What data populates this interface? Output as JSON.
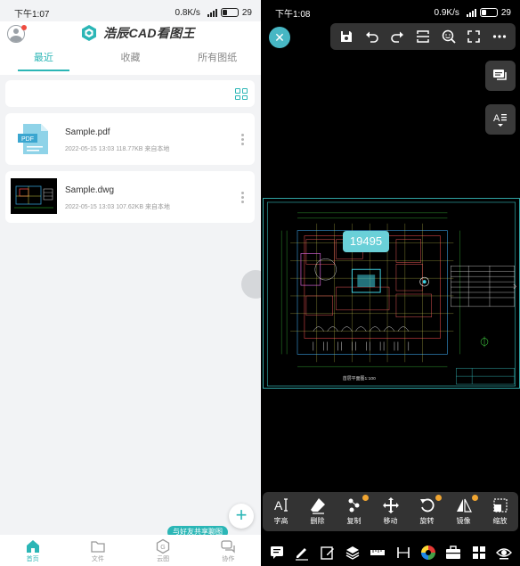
{
  "left": {
    "status": {
      "time": "下午1:07",
      "speed": "0.8K/s",
      "battery": "29"
    },
    "app_title": "浩辰CAD看图王",
    "tabs": [
      "最近",
      "收藏",
      "所有图纸"
    ],
    "files": [
      {
        "name": "Sample.pdf",
        "date": "2022-05-15 13:03",
        "size": "118.77KB",
        "source": "来自本地",
        "type": "PDF"
      },
      {
        "name": "Sample.dwg",
        "date": "2022-05-15 13:03",
        "size": "107.62KB",
        "source": "来自本地",
        "type": "DWG"
      }
    ],
    "share_bubble": "与好友共享聊图",
    "fab_label": "+",
    "bottom_nav": [
      "首页",
      "文件",
      "云图",
      "协作"
    ]
  },
  "right": {
    "status": {
      "time": "下午1:08",
      "speed": "0.9K/s",
      "battery": "29"
    },
    "dimension_value": "19495",
    "drawing_caption": "首层平面图1:100",
    "edit_tools": [
      {
        "label": "字高",
        "icon": "text-height-icon",
        "badge": false
      },
      {
        "label": "删除",
        "icon": "eraser-icon",
        "badge": false
      },
      {
        "label": "复制",
        "icon": "copy-icon",
        "badge": true
      },
      {
        "label": "移动",
        "icon": "move-icon",
        "badge": false
      },
      {
        "label": "旋转",
        "icon": "rotate-icon",
        "badge": true
      },
      {
        "label": "镜像",
        "icon": "mirror-icon",
        "badge": true
      },
      {
        "label": "缩放",
        "icon": "scale-icon",
        "badge": false
      }
    ],
    "bottom_tools": [
      "comment-icon",
      "pencil-icon",
      "edit-icon",
      "layers-icon",
      "ruler-icon",
      "measure-icon",
      "color-icon",
      "toolbox-icon",
      "grid-icon",
      "eye-icon"
    ],
    "accent": "#47b7c4"
  }
}
